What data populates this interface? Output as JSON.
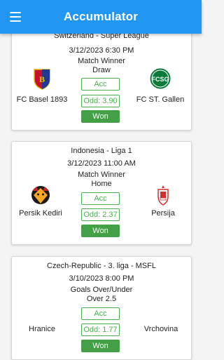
{
  "app": {
    "title": "Accumulator"
  },
  "colors": {
    "appbar": "#2196f3",
    "won": "#43a047",
    "acc_border": "#4caf50"
  },
  "bets": [
    {
      "league": "Switzerland - Super League",
      "datetime": "3/12/2023 6:30 PM",
      "market": "Match Winner",
      "selection": "Draw",
      "acc_label": "Acc",
      "odd_label": "Odd: 3.90",
      "result": "Won",
      "home": {
        "name": "FC Basel 1893",
        "logo": "fc-basel-logo"
      },
      "away": {
        "name": "FC ST. Gallen",
        "logo": "fc-st-gallen-logo"
      }
    },
    {
      "league": "Indonesia - Liga 1",
      "datetime": "3/12/2023 11:00 AM",
      "market": "Match Winner",
      "selection": "Home",
      "acc_label": "Acc",
      "odd_label": "Odd: 2.37",
      "result": "Won",
      "home": {
        "name": "Persik Kediri",
        "logo": "persik-kediri-logo"
      },
      "away": {
        "name": "Persija",
        "logo": "persija-logo"
      }
    },
    {
      "league": "Czech-Republic - 3. liga - MSFL",
      "datetime": "3/10/2023 8:00 PM",
      "market": "Goals Over/Under",
      "selection": "Over 2.5",
      "acc_label": "Acc",
      "odd_label": "Odd: 1.77",
      "result": "Won",
      "home": {
        "name": "Hranice",
        "logo": ""
      },
      "away": {
        "name": "Vrchovina",
        "logo": ""
      }
    }
  ]
}
